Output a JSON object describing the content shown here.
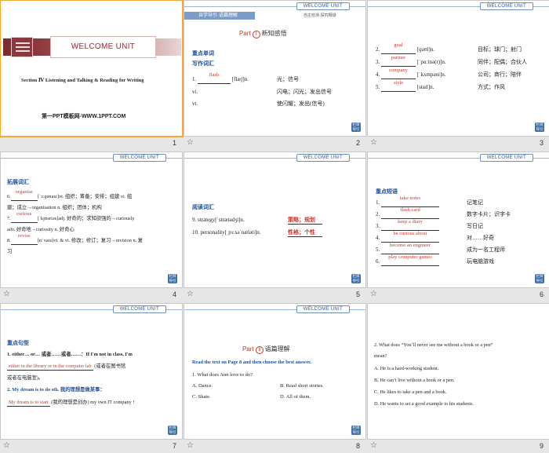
{
  "header_tab": "WELCOME UNIT",
  "back_label": "栏目\n导引",
  "star_glyph": "☆",
  "slides": [
    {
      "num": "1",
      "title": "WELCOME UNIT",
      "section": "Section Ⅳ Listening and Talking & Reading for Writing",
      "source": "第一PPT模板网-WWW.1PPT.COM"
    },
    {
      "num": "2",
      "banner": "自学导引·语篇理解",
      "subnav": "自主检测·探究释疑",
      "part_label": "Part",
      "part_num": "Ⅰ",
      "part_title": "新知感悟",
      "heading1": "重点单词",
      "heading2": "写作词汇",
      "rows": [
        {
          "n": "1.",
          "ans": "flash",
          "ipa": "[flæʃ]n.",
          "cn": "光；信号"
        },
        {
          "n": "vi.",
          "ans": "",
          "ipa": "",
          "cn": "闪电；闪光；发出信号"
        },
        {
          "n": "vt.",
          "ans": "",
          "ipa": "",
          "cn": "使闪耀；发出(信号)"
        }
      ]
    },
    {
      "num": "3",
      "rows": [
        {
          "n": "2.",
          "ans": "goal",
          "ipa": "[ɡəʊl]n.",
          "cn": "目标；球门；射门"
        },
        {
          "n": "3.",
          "ans": "partner",
          "ipa": "[ˈpɑːtnə(r)]n.",
          "cn": "同伴；配偶；合伙人"
        },
        {
          "n": "4.",
          "ans": "company",
          "ipa": "[ˈkʌmpəni]n.",
          "cn": "公司；商行；陪伴"
        },
        {
          "n": "5.",
          "ans": "style",
          "ipa": "[staɪl]n.",
          "cn": "方式；作风"
        }
      ]
    },
    {
      "num": "4",
      "heading": "拓展词汇",
      "lines": [
        {
          "n": "6.",
          "ans": "organise",
          "text": "[ˈɔːɡənaɪz]vt. 组织；筹备；安排；组建 vi. 组"
        },
        {
          "n": "",
          "ans": "",
          "text": "建；成立→organisation n. 组织；团体；机构"
        },
        {
          "n": "7.",
          "ans": "curious",
          "text": "[ˈkjʊəriəs]adj. 好奇的；求知欲强的→curiously"
        },
        {
          "n": "",
          "ans": "",
          "text": "adv. 好奇地→curiosity n. 好奇心"
        },
        {
          "n": "8.",
          "ans": "revise",
          "text": "[rɪˈvaɪz]vt. & vi. 修改；修订；复习→revision n. 复"
        },
        {
          "n": "",
          "ans": "",
          "text": "习"
        }
      ]
    },
    {
      "num": "5",
      "heading": "阅读词汇",
      "rows": [
        {
          "n": "9.",
          "text": "strategy[ˈstrætədʒi]n.",
          "cn": "策略；规划"
        },
        {
          "n": "10.",
          "text": "personality[ˌpɜːsəˈnæləti]n.",
          "cn": "性格；个性"
        }
      ]
    },
    {
      "num": "6",
      "heading": "重点短语",
      "rows": [
        {
          "n": "1.",
          "ans": "take notes",
          "cn": "记笔记"
        },
        {
          "n": "2.",
          "ans": "flash card",
          "cn": "数字卡片；识字卡"
        },
        {
          "n": "3.",
          "ans": "keep a diary",
          "cn": "写日记"
        },
        {
          "n": "4.",
          "ans": "be curious about",
          "cn": "对……好奇"
        },
        {
          "n": "5.",
          "ans": "become an engineer",
          "cn": "成为一名工程师"
        },
        {
          "n": "6.",
          "ans": "play computer games",
          "cn": "玩电脑游戏"
        }
      ]
    },
    {
      "num": "7",
      "heading": "重点句型",
      "l1": "1. either… or… 或者……或者……：If I'm not in class, I'm",
      "ans1": "either in the library or in the computer lab",
      "l1b": "(或者在图书馆",
      "l1c": "或者在电脑室)。",
      "l2": "2. My dream is to do sth. 我的理想是做某事：",
      "ans2": "My dream is to start",
      "l2b": "(我的理想是创办) my own IT company !"
    },
    {
      "num": "8",
      "part_label": "Part",
      "part_num": "Ⅱ",
      "part_title": "语篇理解",
      "instr": "Read the text on Page 8 and then choose the best answer.",
      "q": "1. What does Ann love to do?",
      "opts": [
        "A. Dance.",
        "B. Read short stories.",
        "C. Skate.",
        "D. All of them."
      ]
    },
    {
      "num": "9",
      "q1": "2. What does “You’ll never see me without a book or a pen”",
      "q2": "mean?",
      "opts": [
        "A. He is a hard-working student.",
        "B. He can’t live without a book or a pen.",
        "C. He likes to take a pen and a book.",
        "D. He wants to set a good example to his students."
      ]
    }
  ]
}
